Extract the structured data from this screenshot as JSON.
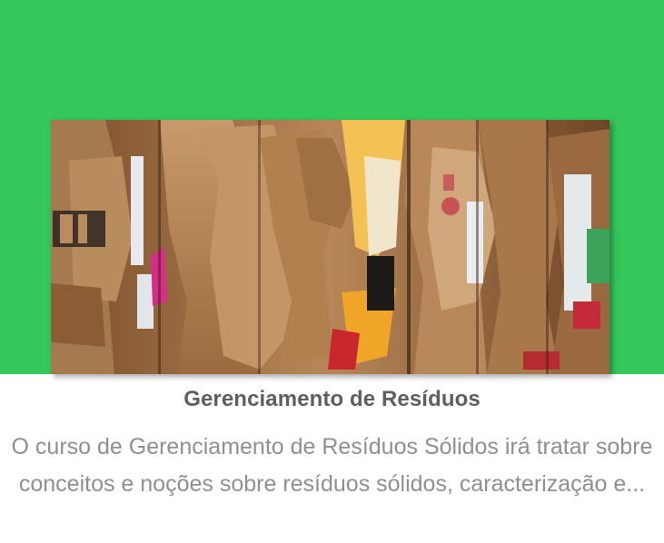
{
  "course_card": {
    "title": "Gerenciamento de Resíduos",
    "description": "O curso de Gerenciamento de Resíduos Sólidos irá tratar sobre conceitos e noções sobre resíduos sólidos, caracterização e...",
    "image_icon": "cardboard-bales-photo",
    "colors": {
      "header_background": "#34c75a",
      "title": "#5f5f5f",
      "description": "#8f8f8f"
    }
  }
}
